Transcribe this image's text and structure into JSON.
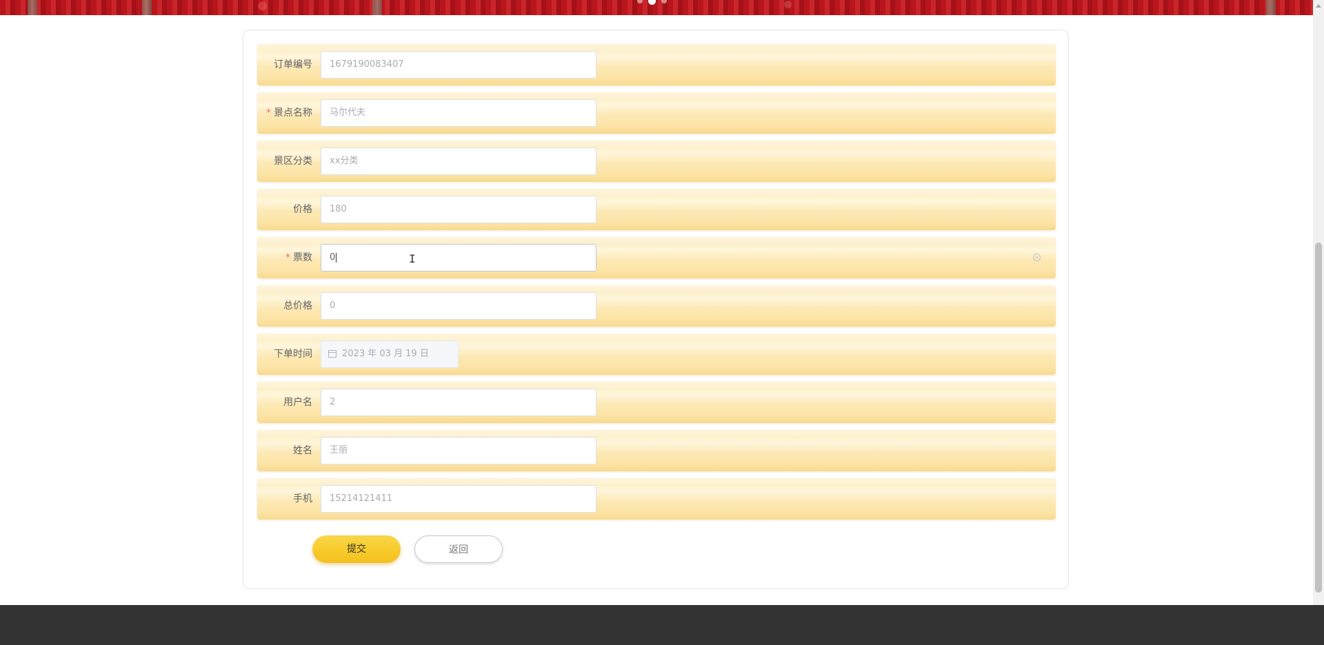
{
  "form": {
    "fields": [
      {
        "label": "订单编号",
        "value": "1679190083407",
        "required": false
      },
      {
        "label": "景点名称",
        "value": "马尔代夫",
        "required": true
      },
      {
        "label": "景区分类",
        "value": "xx分类",
        "required": false
      },
      {
        "label": "价格",
        "value": "180",
        "required": false
      },
      {
        "label": "票数",
        "value": "0",
        "required": true
      },
      {
        "label": "总价格",
        "value": "0",
        "required": false
      },
      {
        "label": "下单时间",
        "value": "2023 年 03 月 19 日",
        "required": false
      },
      {
        "label": "用户名",
        "value": "2",
        "required": false
      },
      {
        "label": "姓名",
        "value": "王丽",
        "required": false
      },
      {
        "label": "手机",
        "value": "15214121411",
        "required": false
      }
    ],
    "required_mark": "*",
    "submit_label": "提交",
    "back_label": "返回"
  },
  "colors": {
    "accent": "#f8cc2c",
    "row_gradient_top": "#fef5dc",
    "row_gradient_bottom": "#f8d98e",
    "required": "#f56c6c",
    "footer": "#333333"
  },
  "icons": {
    "date_field": "calendar-icon",
    "ticket_field": "clear-icon"
  }
}
